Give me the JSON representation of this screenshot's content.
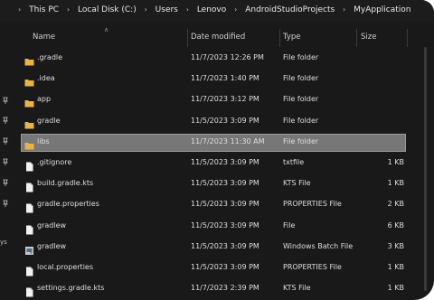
{
  "breadcrumb": [
    "This PC",
    "Local Disk (C:)",
    "Users",
    "Lenovo",
    "AndroidStudioProjects",
    "MyApplication"
  ],
  "columns": {
    "name": "Name",
    "date": "Date modified",
    "type": "Type",
    "size": "Size"
  },
  "left_label": "ys",
  "files": [
    {
      "name": ".gradle",
      "date": "11/7/2023 12:26 PM",
      "type": "File folder",
      "size": "",
      "icon": "folder-icon"
    },
    {
      "name": ".idea",
      "date": "11/7/2023 1:40 PM",
      "type": "File folder",
      "size": "",
      "icon": "folder-icon"
    },
    {
      "name": "app",
      "date": "11/7/2023 3:12 PM",
      "type": "File folder",
      "size": "",
      "icon": "folder-icon"
    },
    {
      "name": "gradle",
      "date": "11/5/2023 3:09 PM",
      "type": "File folder",
      "size": "",
      "icon": "folder-icon"
    },
    {
      "name": "libs",
      "date": "11/7/2023 11:30 AM",
      "type": "File folder",
      "size": "",
      "icon": "folder-icon",
      "selected": true
    },
    {
      "name": ".gitignore",
      "date": "11/5/2023 3:09 PM",
      "type": "txtfile",
      "size": "1 KB",
      "icon": "file-icon"
    },
    {
      "name": "build.gradle.kts",
      "date": "11/5/2023 3:09 PM",
      "type": "KTS File",
      "size": "1 KB",
      "icon": "file-icon"
    },
    {
      "name": "gradle.properties",
      "date": "11/5/2023 3:09 PM",
      "type": "PROPERTIES File",
      "size": "2 KB",
      "icon": "file-icon"
    },
    {
      "name": "gradlew",
      "date": "11/5/2023 3:09 PM",
      "type": "File",
      "size": "6 KB",
      "icon": "file-icon"
    },
    {
      "name": "gradlew",
      "date": "11/5/2023 3:09 PM",
      "type": "Windows Batch File",
      "size": "3 KB",
      "icon": "batch-file-icon"
    },
    {
      "name": "local.properties",
      "date": "11/5/2023 3:09 PM",
      "type": "PROPERTIES File",
      "size": "1 KB",
      "icon": "file-icon"
    },
    {
      "name": "settings.gradle.kts",
      "date": "11/7/2023 2:39 PM",
      "type": "KTS File",
      "size": "1 KB",
      "icon": "file-icon"
    }
  ],
  "colors": {
    "background": "#191919",
    "folder": "#e8b44a",
    "selection": "#777777",
    "text": "#dedede"
  }
}
